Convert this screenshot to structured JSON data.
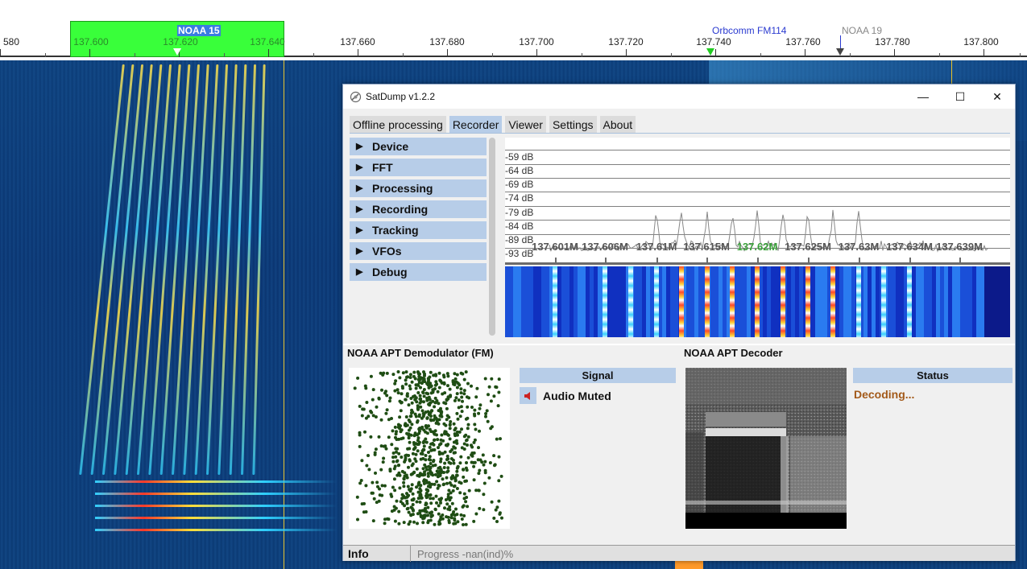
{
  "ruler": {
    "ticks": [
      "580",
      "137.600",
      "137.620",
      "137.640",
      "137.660",
      "137.680",
      "137.700",
      "137.720",
      "137.740",
      "137.760",
      "137.780",
      "137.800"
    ],
    "stations": {
      "noaa15": "NOAA 15",
      "orbcomm": "Orbcomm FM114",
      "noaa19": "NOAA 19"
    }
  },
  "window": {
    "title": "SatDump v1.2.2",
    "controls": {
      "minimize": "—",
      "maximize": "☐",
      "close": "✕"
    }
  },
  "tabs": [
    {
      "label": "Offline processing",
      "active": false
    },
    {
      "label": "Recorder",
      "active": true
    },
    {
      "label": "Viewer",
      "active": false
    },
    {
      "label": "Settings",
      "active": false
    },
    {
      "label": "About",
      "active": false
    }
  ],
  "sidebar": {
    "items": [
      {
        "label": "Device"
      },
      {
        "label": "FFT"
      },
      {
        "label": "Processing"
      },
      {
        "label": "Recording"
      },
      {
        "label": "Tracking"
      },
      {
        "label": "VFOs"
      },
      {
        "label": "Debug"
      }
    ]
  },
  "fft": {
    "db_labels": [
      "-59 dB",
      "-64 dB",
      "-69 dB",
      "-74 dB",
      "-79 dB",
      "-84 dB",
      "-89 dB",
      "-93 dB"
    ],
    "freq_labels": [
      "137.601M",
      "137.606M",
      "137.61M",
      "137.615M",
      "137.62M",
      "137.625M",
      "137.63M",
      "137.634M",
      "137.639M"
    ],
    "center_freq": "137.62M"
  },
  "demod": {
    "title": "NOAA APT Demodulator (FM)",
    "signal_header": "Signal",
    "mute_label": "Audio Muted"
  },
  "decoder": {
    "title": "NOAA APT Decoder",
    "status_header": "Status",
    "status_text": "Decoding..."
  },
  "statusbar": {
    "info": "Info",
    "progress": "Progress -nan(ind)%"
  },
  "colors": {
    "accent": "#b7cde8",
    "station_box": "#39ff3a",
    "constellation_points": "#1f4d14",
    "decoding_status": "#a35a1a"
  }
}
